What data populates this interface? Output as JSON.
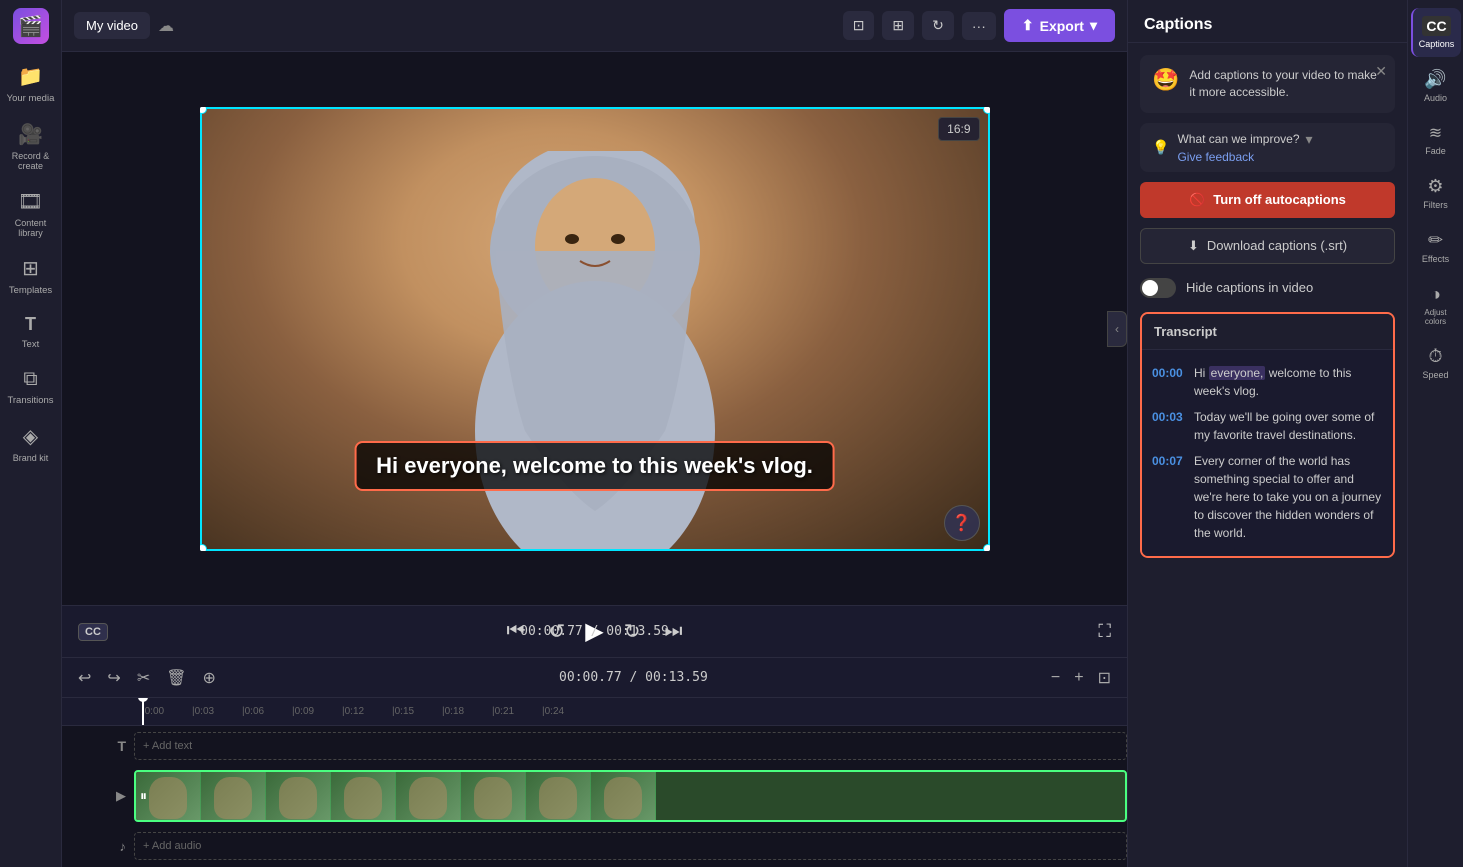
{
  "app": {
    "logo": "🎬",
    "title": "My video",
    "cloud_icon": "☁"
  },
  "sidebar": {
    "items": [
      {
        "id": "your-media",
        "icon": "📁",
        "label": "Your media"
      },
      {
        "id": "record-create",
        "icon": "🎥",
        "label": "Record & create"
      },
      {
        "id": "content-library",
        "icon": "🎞",
        "label": "Content library"
      },
      {
        "id": "templates",
        "icon": "⊞",
        "label": "Templates"
      },
      {
        "id": "text",
        "icon": "T",
        "label": "Text"
      },
      {
        "id": "transitions",
        "icon": "⧉",
        "label": "Transitions"
      },
      {
        "id": "brand-kit",
        "icon": "◈",
        "label": "Brand kit"
      }
    ]
  },
  "topbar": {
    "tools": [
      {
        "id": "crop",
        "icon": "⊡",
        "label": "Crop"
      },
      {
        "id": "layout",
        "icon": "⊞",
        "label": "Layout"
      },
      {
        "id": "rotate",
        "icon": "↻",
        "label": "Rotate"
      },
      {
        "id": "more",
        "icon": "···",
        "label": "More"
      }
    ],
    "export_label": "Export",
    "aspect_ratio": "16:9"
  },
  "caption_overlay": "Hi everyone, welcome to this week's vlog.",
  "playback": {
    "time_current": "00:00.77",
    "time_total": "00:13.59",
    "cc_label": "CC"
  },
  "timeline": {
    "toolbar_buttons": [
      "↩",
      "↪",
      "✂",
      "🗑",
      "⊕"
    ],
    "zoom_buttons": [
      "−",
      "+",
      "⊡"
    ],
    "ruler_marks": [
      "0:00",
      "0:03",
      "0:06",
      "0:09",
      "0:12",
      "0:15",
      "0:18",
      "0:21",
      "0:24"
    ],
    "tracks": [
      {
        "type": "text",
        "icon": "T",
        "label": "Add text",
        "is_placeholder": true
      },
      {
        "type": "video",
        "icon": "▶",
        "label": "video clip"
      },
      {
        "type": "audio",
        "icon": "♪",
        "label": "Add audio",
        "is_placeholder": true
      }
    ]
  },
  "captions_panel": {
    "title": "Captions",
    "tip_emoji": "🤩",
    "tip_text": "Add captions to your video to make it more accessible.",
    "feedback_label": "What can we improve?",
    "feedback_link": "Give feedback",
    "autocaptions_btn": "Turn off autocaptions",
    "download_btn": "Download captions (.srt)",
    "hide_label": "Hide captions in video",
    "transcript_title": "Transcript",
    "transcript_entries": [
      {
        "time": "00:00",
        "text_parts": [
          {
            "text": "Hi ",
            "highlight": false
          },
          {
            "text": "everyone,",
            "highlight": true
          },
          {
            "text": " welcome to this week's vlog.",
            "highlight": false
          }
        ]
      },
      {
        "time": "00:03",
        "text": "Today we'll be going over some of my favorite travel destinations.",
        "highlight": false
      },
      {
        "time": "00:07",
        "text": "Every corner of the world has something special to offer and we're here to take you on a journey to discover the hidden wonders of the world.",
        "highlight": false
      }
    ]
  },
  "tools_sidebar": {
    "items": [
      {
        "id": "captions",
        "icon": "CC",
        "label": "Captions",
        "active": true
      },
      {
        "id": "audio",
        "icon": "🔊",
        "label": "Audio"
      },
      {
        "id": "fade",
        "icon": "≋",
        "label": "Fade"
      },
      {
        "id": "filters",
        "icon": "⚙",
        "label": "Filters"
      },
      {
        "id": "effects",
        "icon": "✏",
        "label": "Effects"
      },
      {
        "id": "adjust-colors",
        "icon": "◑",
        "label": "Adjust colors"
      },
      {
        "id": "speed",
        "icon": "⏱",
        "label": "Speed"
      }
    ]
  }
}
